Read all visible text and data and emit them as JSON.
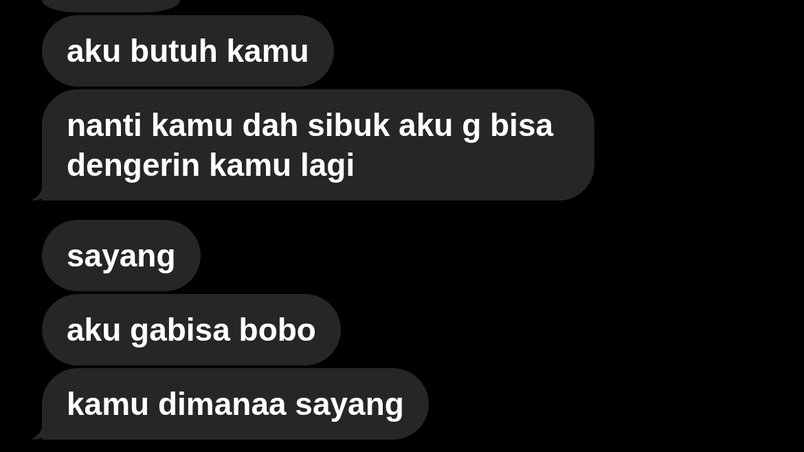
{
  "groups": [
    {
      "messages": [
        {
          "kind": "clipped"
        },
        {
          "kind": "text",
          "text": "aku butuh kamu",
          "tail": false
        },
        {
          "kind": "text",
          "text": "nanti kamu dah sibuk aku g bisa dengerin kamu lagi",
          "tail": true
        }
      ]
    },
    {
      "messages": [
        {
          "kind": "text",
          "text": "sayang",
          "tail": false
        },
        {
          "kind": "text",
          "text": "aku gabisa bobo",
          "tail": false
        },
        {
          "kind": "text",
          "text": "kamu dimanaa sayang",
          "tail": true
        }
      ]
    }
  ]
}
